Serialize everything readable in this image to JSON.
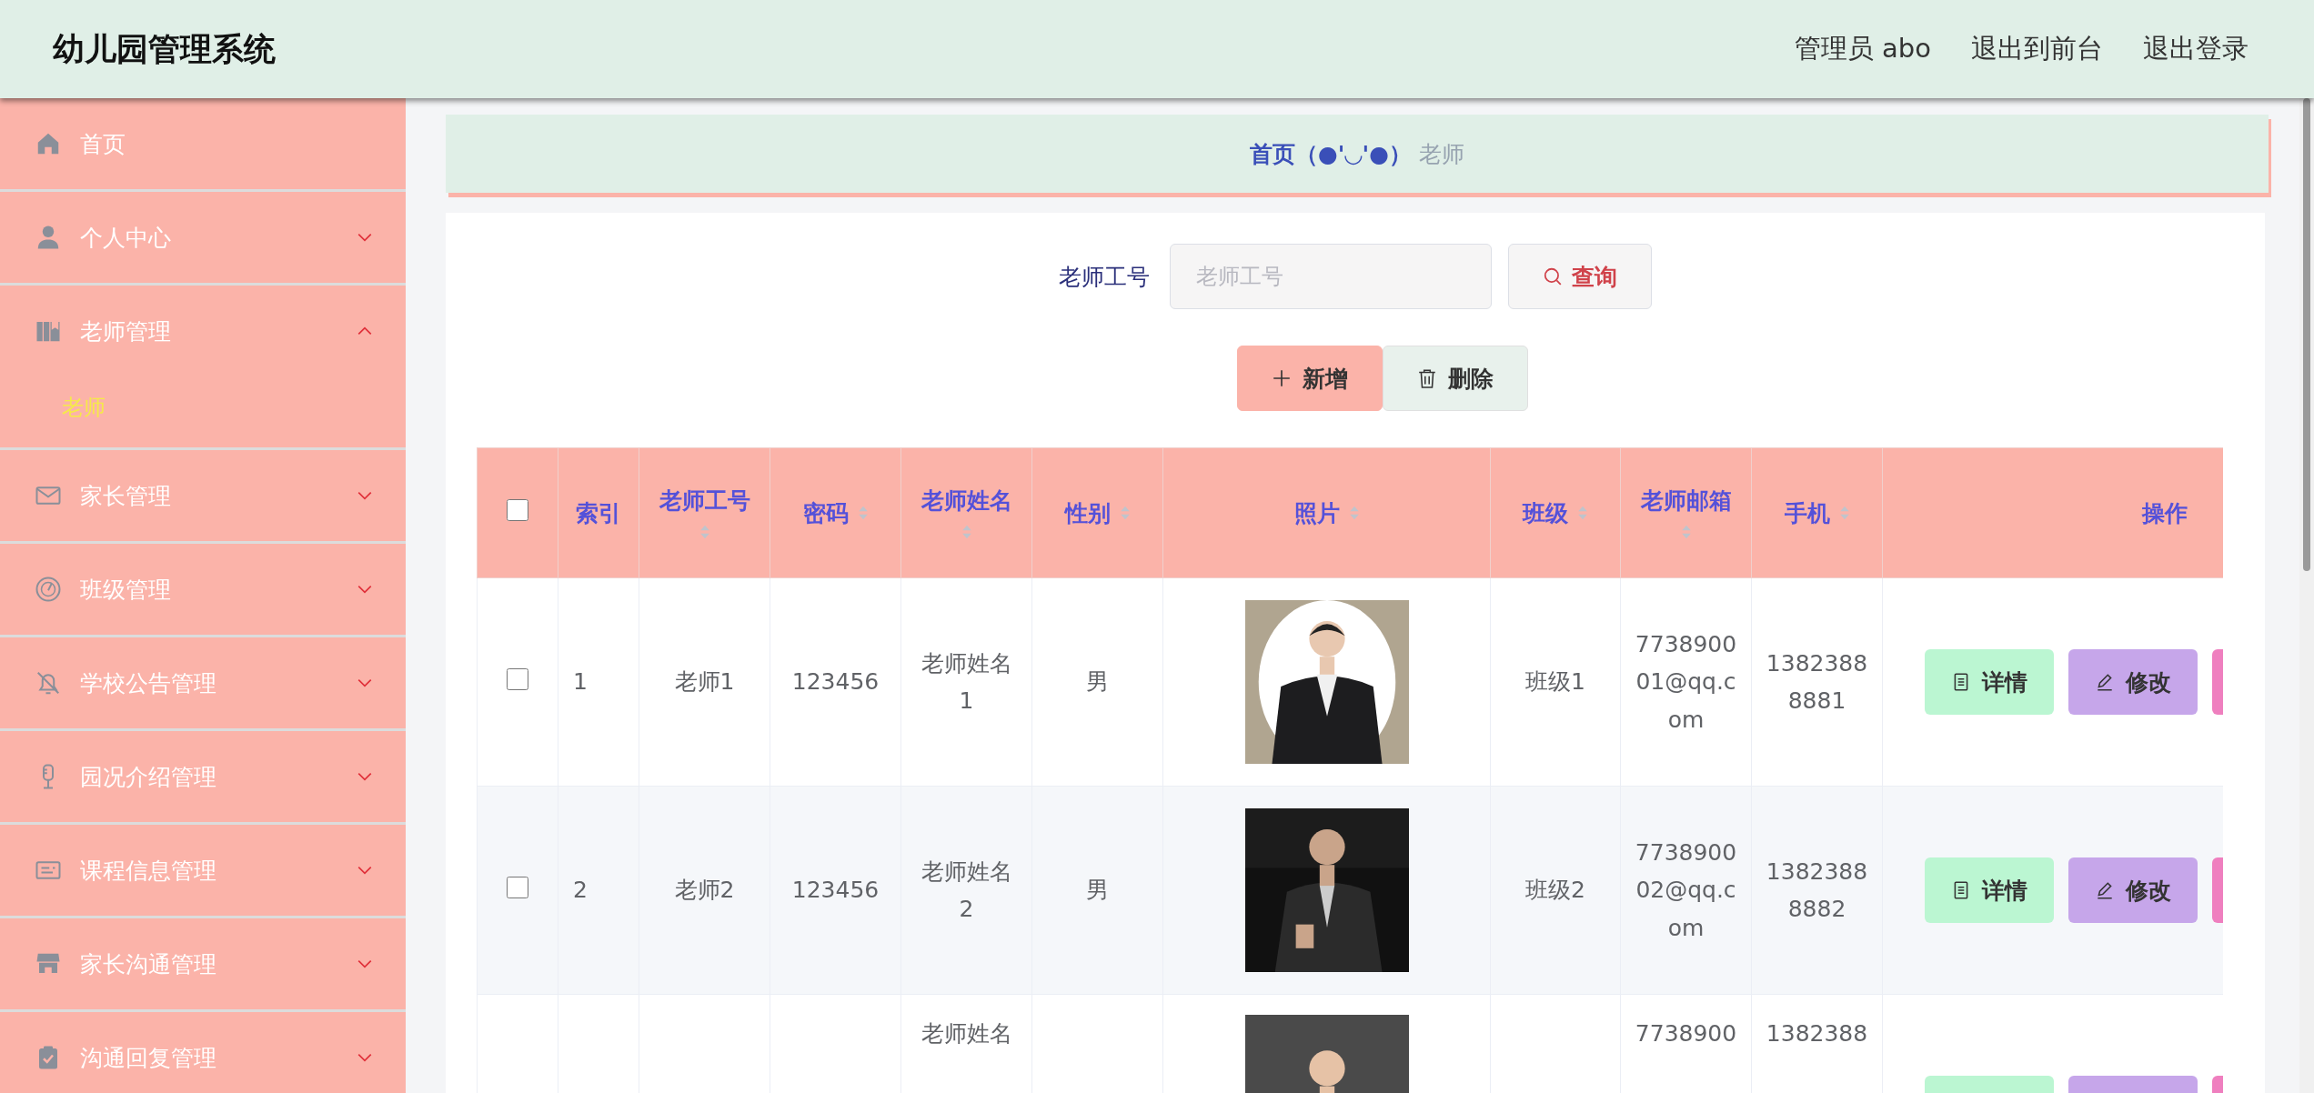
{
  "header": {
    "title": "幼儿园管理系统",
    "links": [
      "管理员 abo",
      "退出到前台",
      "退出登录"
    ]
  },
  "sidebar": {
    "items": [
      {
        "label": "首页",
        "kind": "home"
      },
      {
        "label": "个人中心",
        "kind": "user",
        "expanded": false
      },
      {
        "label": "老师管理",
        "kind": "book",
        "expanded": true,
        "children": [
          {
            "label": "老师",
            "selected": true
          }
        ]
      },
      {
        "label": "家长管理",
        "kind": "mail",
        "expanded": false
      },
      {
        "label": "班级管理",
        "kind": "gauge",
        "expanded": false
      },
      {
        "label": "学校公告管理",
        "kind": "bell",
        "expanded": false
      },
      {
        "label": "园况介绍管理",
        "kind": "mic",
        "expanded": false
      },
      {
        "label": "课程信息管理",
        "kind": "card",
        "expanded": false
      },
      {
        "label": "家长沟通管理",
        "kind": "shop",
        "expanded": false
      },
      {
        "label": "沟通回复管理",
        "kind": "clipboard",
        "expanded": false
      }
    ]
  },
  "breadcrumb": {
    "home": "首页（●'◡'●）",
    "current": "老师"
  },
  "search": {
    "label": "老师工号",
    "placeholder": "老师工号",
    "button": "查询"
  },
  "actions": [
    {
      "label": "新增",
      "kind": "add"
    },
    {
      "label": "删除",
      "kind": "delete"
    }
  ],
  "table": {
    "all_checked": false,
    "columns": [
      {
        "label": "索引",
        "sortable": false
      },
      {
        "label": "老师工号",
        "sortable": true
      },
      {
        "label": "密码",
        "sortable": true
      },
      {
        "label": "老师姓名",
        "sortable": true
      },
      {
        "label": "性别",
        "sortable": true
      },
      {
        "label": "照片",
        "sortable": true
      },
      {
        "label": "班级",
        "sortable": true
      },
      {
        "label": "老师邮箱",
        "sortable": true
      },
      {
        "label": "手机",
        "sortable": true
      },
      {
        "label": "操作",
        "sortable": false
      }
    ],
    "rows": [
      {
        "checked": false,
        "cells": [
          "1",
          "老师1",
          "123456",
          "老师姓名1",
          "男",
          null,
          "班级1",
          "773890001@qq.com",
          "13823888881"
        ],
        "actions": [
          {
            "label": "详情",
            "kind": "detail"
          },
          {
            "label": "修改",
            "kind": "edit"
          },
          {
            "kind": "extra"
          }
        ]
      },
      {
        "checked": false,
        "cells": [
          "2",
          "老师2",
          "123456",
          "老师姓名2",
          "男",
          null,
          "班级2",
          "773890002@qq.com",
          "13823888882"
        ],
        "actions": [
          {
            "label": "详情",
            "kind": "detail"
          },
          {
            "label": "修改",
            "kind": "edit"
          },
          {
            "kind": "extra"
          }
        ]
      },
      {
        "cells": [
          null,
          null,
          null,
          "老师姓名",
          null,
          null,
          null,
          "7738900",
          "1382388"
        ],
        "actions": [
          {
            "kind": "detail"
          },
          {
            "kind": "edit"
          },
          {
            "kind": "extra"
          }
        ]
      }
    ]
  }
}
